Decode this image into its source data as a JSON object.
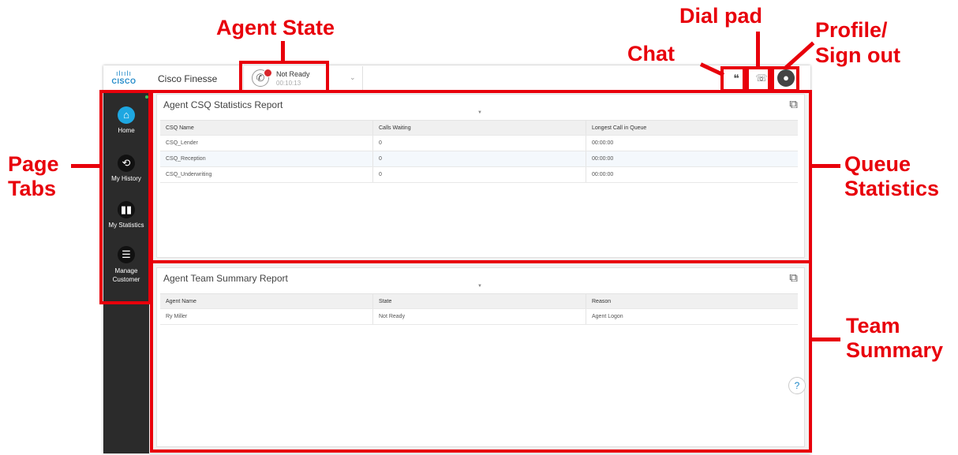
{
  "annotations": {
    "agent_state": "Agent State",
    "dial_pad": "Dial pad",
    "chat": "Chat",
    "profile_line1": "Profile/",
    "profile_line2": "Sign out",
    "page_line1": "Page",
    "page_line2": "Tabs",
    "queue_line1": "Queue",
    "queue_line2": "Statistics",
    "team_line1": "Team",
    "team_line2": "Summary",
    "color": "#e8000b"
  },
  "header": {
    "logo_text": "CISCO",
    "app_title": "Cisco Finesse",
    "agent_state": {
      "label": "Not Ready",
      "timer": "00:10:13",
      "status_color": "#d9262b"
    },
    "icons": [
      "chat-icon",
      "dial-pad-icon",
      "profile-icon"
    ]
  },
  "sidebar": {
    "items": [
      {
        "label": "Home",
        "icon": "home-icon",
        "active": true
      },
      {
        "label": "My History",
        "icon": "history-icon",
        "active": false
      },
      {
        "label": "My Statistics",
        "icon": "statistics-icon",
        "active": false
      },
      {
        "label_line1": "Manage",
        "label_line2": "Customer",
        "icon": "manage-customer-icon",
        "active": false
      }
    ]
  },
  "csq_report": {
    "title": "Agent CSQ Statistics Report",
    "columns": [
      "CSQ Name",
      "Calls Waiting",
      "Longest Call in Queue"
    ],
    "rows": [
      [
        "CSQ_Lender",
        "0",
        "00:00:00"
      ],
      [
        "CSQ_Reception",
        "0",
        "00:00:00"
      ],
      [
        "CSQ_Underwriting",
        "0",
        "00:00:00"
      ]
    ]
  },
  "team_report": {
    "title": "Agent Team Summary Report",
    "columns": [
      "Agent Name",
      "State",
      "Reason"
    ],
    "rows": [
      [
        "Ry Miller",
        "Not Ready",
        "Agent Logon"
      ]
    ]
  }
}
